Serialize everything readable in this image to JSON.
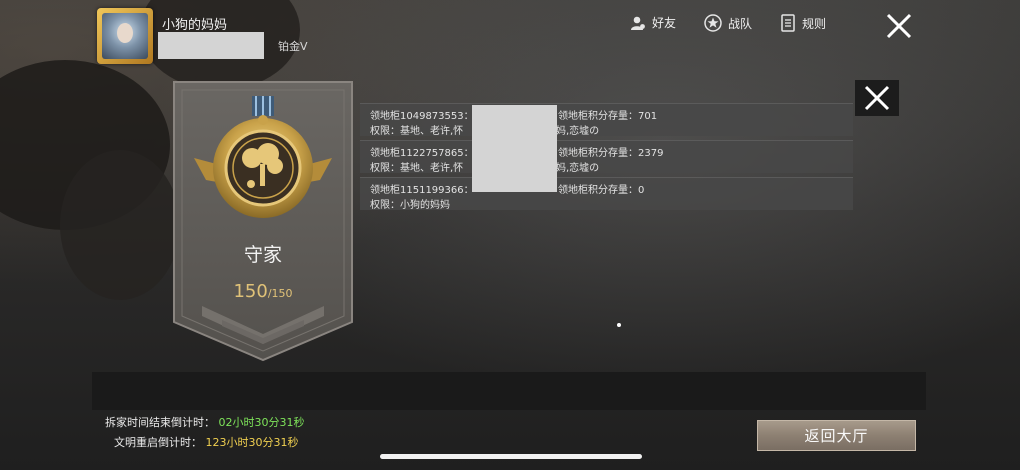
{
  "user": {
    "name": "小狗的妈妈",
    "rank": "铂金V"
  },
  "nav": {
    "friends": "好友",
    "team": "战队",
    "rules": "规则"
  },
  "medal": {
    "title": "守家",
    "score_current": "150",
    "score_total": "/150"
  },
  "cabinets": [
    {
      "id_label": "领地柜1049873553：",
      "points": "领地柜积分存量：701",
      "perm_label": "权限：基地、老许,怀",
      "perm_tail": "妈妈,恋墟の"
    },
    {
      "id_label": "领地柜1122757865：",
      "points": "领地柜积分存量：2379",
      "perm_label": "权限：基地、老许,怀",
      "perm_tail": "妈妈,恋墟の"
    },
    {
      "id_label": "领地柜1151199366：",
      "points": "领地柜积分存量：0",
      "perm_label": "权限：小狗的妈妈",
      "perm_tail": ""
    }
  ],
  "timers": {
    "demolish_label": "拆家时间结束倒计时：",
    "demolish_value": "02小时30分31秒",
    "restart_label": "文明重启倒计时：",
    "restart_value": "123小时30分31秒"
  },
  "buttons": {
    "return_lobby": "返回大厅"
  },
  "colors": {
    "accent_green": "#7ee35a",
    "accent_yellow": "#f0d050",
    "medal_gold": "#c9a24a"
  },
  "icons": {
    "friends": "person-icon",
    "team": "star-badge-icon",
    "rules": "document-icon",
    "close": "close-icon"
  }
}
